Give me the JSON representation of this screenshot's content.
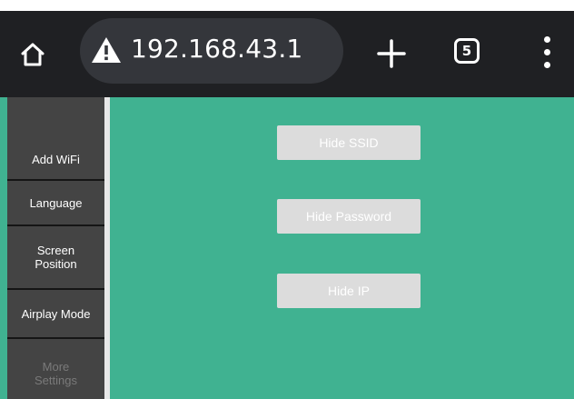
{
  "browser": {
    "url": "192.168.43.1",
    "tab_count": "5",
    "icons": [
      "home-icon",
      "not-secure-warning-icon",
      "new-tab-plus-icon",
      "tab-switcher-icon",
      "more-menu-icon"
    ]
  },
  "sidebar": {
    "items": [
      {
        "label": "Add WiFi",
        "enabled": true
      },
      {
        "label": "Language",
        "enabled": true
      },
      {
        "label": "Screen\nPosition",
        "enabled": true
      },
      {
        "label": "Airplay Mode",
        "enabled": true
      },
      {
        "label": "More\nSettings",
        "enabled": false
      }
    ]
  },
  "main": {
    "buttons": [
      {
        "label": "Hide SSID"
      },
      {
        "label": "Hide Password"
      },
      {
        "label": "Hide IP"
      }
    ]
  },
  "colors": {
    "page_background": "#40b291",
    "sidebar_background": "#444444",
    "toolbar_background": "#1f2023",
    "button_background": "#dcdcdc"
  }
}
